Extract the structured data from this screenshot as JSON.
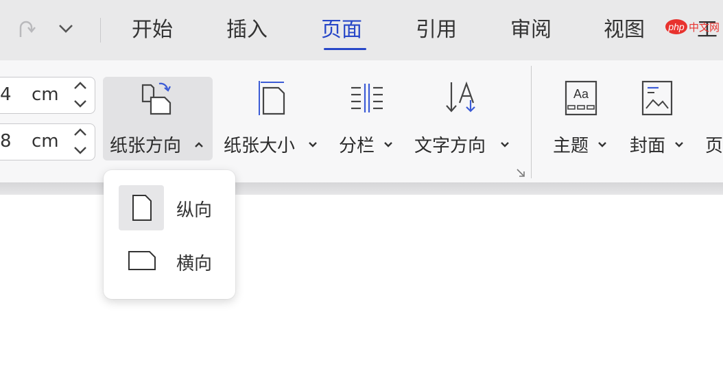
{
  "tabs": [
    {
      "label": "开始",
      "active": false
    },
    {
      "label": "插入",
      "active": false
    },
    {
      "label": "页面",
      "active": true
    },
    {
      "label": "引用",
      "active": false
    },
    {
      "label": "审阅",
      "active": false
    },
    {
      "label": "视图",
      "active": false
    },
    {
      "label": "工",
      "active": false
    }
  ],
  "margins": {
    "top_value": "4",
    "bottom_value": "8",
    "unit": "cm"
  },
  "ribbon": {
    "orientation_label": "纸张方向",
    "size_label": "纸张大小",
    "columns_label": "分栏",
    "text_direction_label": "文字方向",
    "theme_label": "主题",
    "cover_label": "封面",
    "page_label": "页"
  },
  "orientation_menu": {
    "portrait_label": "纵向",
    "landscape_label": "横向"
  },
  "watermark": {
    "php": "php",
    "site": "中文网"
  },
  "colors": {
    "accent": "#2747c8",
    "watermark_red": "#e8322e"
  },
  "icons": {
    "redo": "redo-icon",
    "customize": "chevron-down-icon"
  }
}
